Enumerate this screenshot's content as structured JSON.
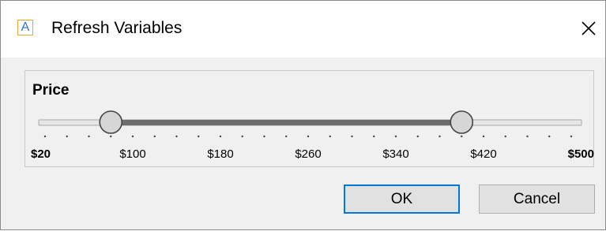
{
  "window": {
    "title": "Refresh Variables",
    "icon": "app-a-icon",
    "icon_letter": "A",
    "close_icon": "close-icon"
  },
  "variable": {
    "label": "Price",
    "min": 20,
    "max": 500,
    "selected_low": 80,
    "selected_high": 400,
    "tick_labels": [
      "$20",
      "$100",
      "$180",
      "$260",
      "$340",
      "$420",
      "$500"
    ]
  },
  "buttons": {
    "ok_label": "OK",
    "cancel_label": "Cancel"
  },
  "colors": {
    "ok_focus_border": "#0078d7",
    "app_icon_border": "#e8a33d",
    "app_icon_letter": "#2f6fd8"
  }
}
